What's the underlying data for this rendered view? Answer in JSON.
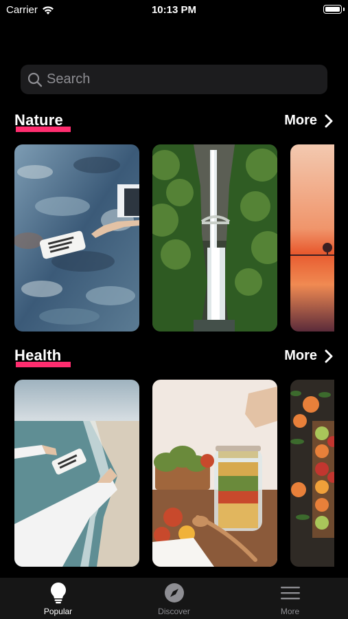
{
  "status_bar": {
    "carrier": "Carrier",
    "time": "10:13 PM"
  },
  "search": {
    "placeholder": "Search"
  },
  "sections": [
    {
      "title": "Nature",
      "more_label": "More",
      "cards": [
        {
          "image": "ocean-rocks-hand-bottle",
          "palette": [
            "#3b5a78",
            "#7aa0b5",
            "#c9d6db",
            "#2b3f55"
          ]
        },
        {
          "image": "waterfall-bridge-forest",
          "palette": [
            "#274a1c",
            "#5c8a3a",
            "#dfe7e8",
            "#3b3b33"
          ]
        },
        {
          "image": "sunset-over-water",
          "palette": [
            "#f3a98c",
            "#e85a2f",
            "#5b2b3a"
          ]
        }
      ]
    },
    {
      "title": "Health",
      "more_label": "More",
      "cards": [
        {
          "image": "beach-hand-bottle",
          "palette": [
            "#bfcad0",
            "#5f8e94",
            "#d8cdbb",
            "#e9ecee"
          ]
        },
        {
          "image": "jar-salad-table",
          "palette": [
            "#f1e8e1",
            "#c8492c",
            "#8b5a3a",
            "#6a8a3b"
          ]
        },
        {
          "image": "citrus-slices-board",
          "palette": [
            "#2f2a25",
            "#e8803a",
            "#a9c65a",
            "#c2362f"
          ]
        }
      ]
    }
  ],
  "tab_bar": {
    "tabs": [
      {
        "label": "Popular",
        "icon": "lightbulb-icon",
        "active": true
      },
      {
        "label": "Discover",
        "icon": "compass-icon",
        "active": false
      },
      {
        "label": "More",
        "icon": "menu-icon",
        "active": false
      }
    ]
  },
  "colors": {
    "accent": "#ff2d6f",
    "background": "#000000",
    "search_bg": "#1c1c1e",
    "tab_bar_bg": "#161616"
  }
}
